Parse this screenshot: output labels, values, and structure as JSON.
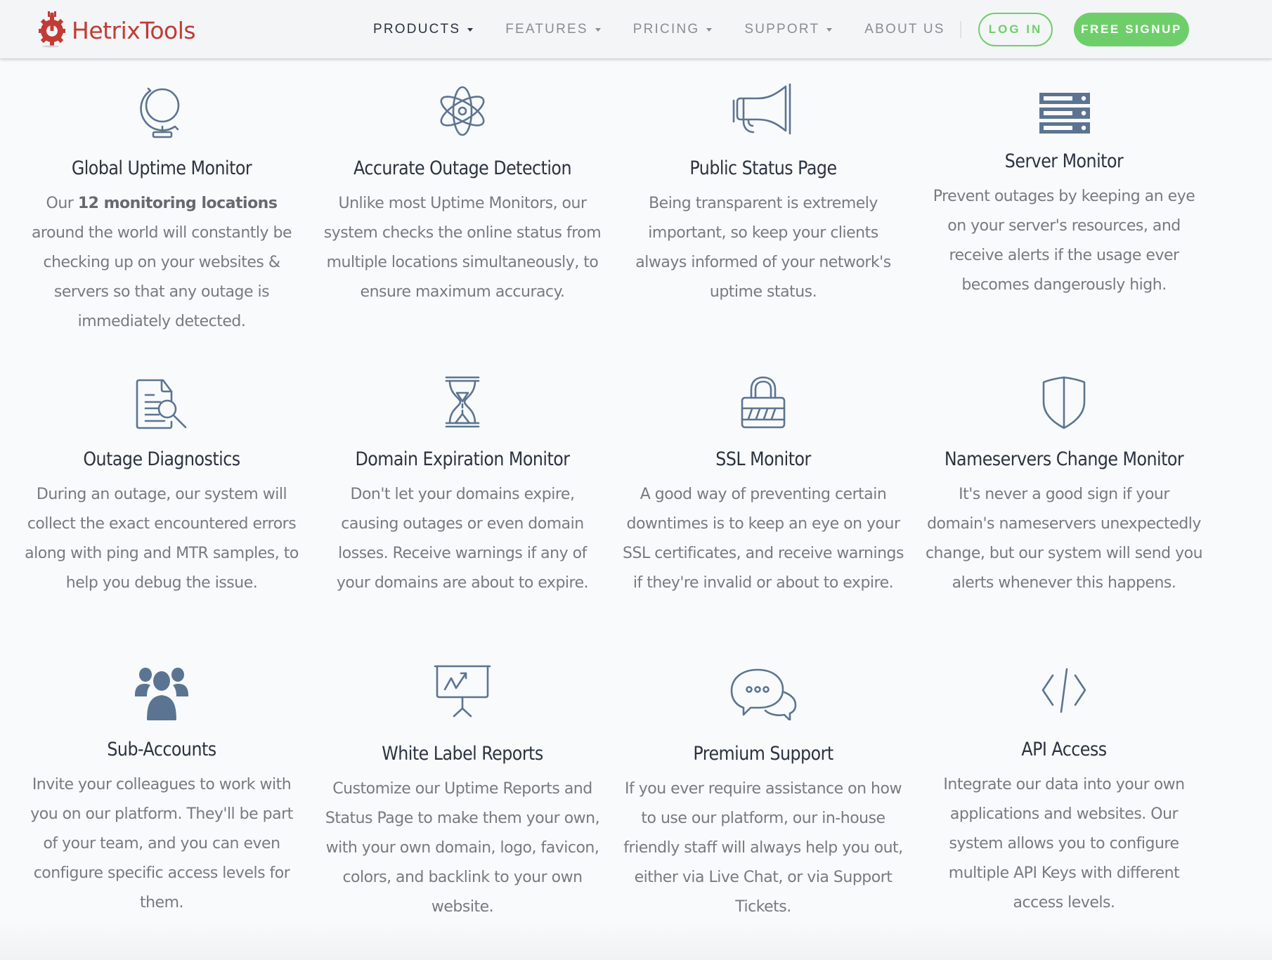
{
  "header": {
    "brand": "HetrixTools",
    "nav": [
      {
        "label": "PRODUCTS",
        "dropdown": true,
        "active": true
      },
      {
        "label": "FEATURES",
        "dropdown": true,
        "active": false
      },
      {
        "label": "PRICING",
        "dropdown": true,
        "active": false
      },
      {
        "label": "SUPPORT",
        "dropdown": true,
        "active": false
      },
      {
        "label": "ABOUT US",
        "dropdown": false,
        "active": false
      }
    ],
    "login_label": "LOG IN",
    "signup_label": "FREE SIGNUP"
  },
  "colors": {
    "brand_red": "#c23b34",
    "accent_green": "#6ecf6a",
    "icon_blue": "#5b7491",
    "heading": "#2b3340",
    "body_text": "#777b80"
  },
  "features": [
    {
      "icon": "globe-icon",
      "title": "Global Uptime Monitor",
      "desc_pre": "Our ",
      "desc_bold": "12 monitoring locations",
      "desc_post": " around the world will constantly be checking up on your websites & servers so that any outage is immediately detected."
    },
    {
      "icon": "atom-icon",
      "title": "Accurate Outage Detection",
      "desc": "Unlike most Uptime Monitors, our system checks the online status from multiple locations simultaneously, to ensure maximum accuracy."
    },
    {
      "icon": "megaphone-icon",
      "title": "Public Status Page",
      "desc": "Being transparent is extremely important, so keep your clients always informed of your network's uptime status."
    },
    {
      "icon": "server-icon",
      "title": "Server Monitor",
      "desc": "Prevent outages by keeping an eye on your server's resources, and receive alerts if the usage ever becomes dangerously high."
    },
    {
      "icon": "document-search-icon",
      "title": "Outage Diagnostics",
      "desc": "During an outage, our system will collect the exact encountered errors along with ping and MTR samples, to help you debug the issue."
    },
    {
      "icon": "hourglass-icon",
      "title": "Domain Expiration Monitor",
      "desc": "Don't let your domains expire, causing outages or even domain losses. Receive warnings if any of your domains are about to expire."
    },
    {
      "icon": "padlock-icon",
      "title": "SSL Monitor",
      "desc": "A good way of preventing certain downtimes is to keep an eye on your SSL certificates, and receive warnings if they're invalid or about to expire."
    },
    {
      "icon": "shield-icon",
      "title": "Nameservers Change Monitor",
      "desc": "It's never a good sign if your domain's nameservers unexpectedly change, but our system will send you alerts whenever this happens."
    },
    {
      "icon": "users-icon",
      "title": "Sub-Accounts",
      "desc": "Invite your colleagues to work with you on our platform. They'll be part of your team, and you can even configure specific access levels for them."
    },
    {
      "icon": "presentation-chart-icon",
      "title": "White Label Reports",
      "desc": "Customize our Uptime Reports and Status Page to make them your own, with your own domain, logo, favicon, colors, and backlink to your own website."
    },
    {
      "icon": "chat-bubbles-icon",
      "title": "Premium Support",
      "desc": "If you ever require assistance on how to use our platform, our in-house friendly staff will always help you out, either via Live Chat, or via Support Tickets."
    },
    {
      "icon": "code-icon",
      "title": "API Access",
      "desc": "Integrate our data into your own applications and websites. Our system allows you to configure multiple API Keys with different access levels."
    }
  ]
}
